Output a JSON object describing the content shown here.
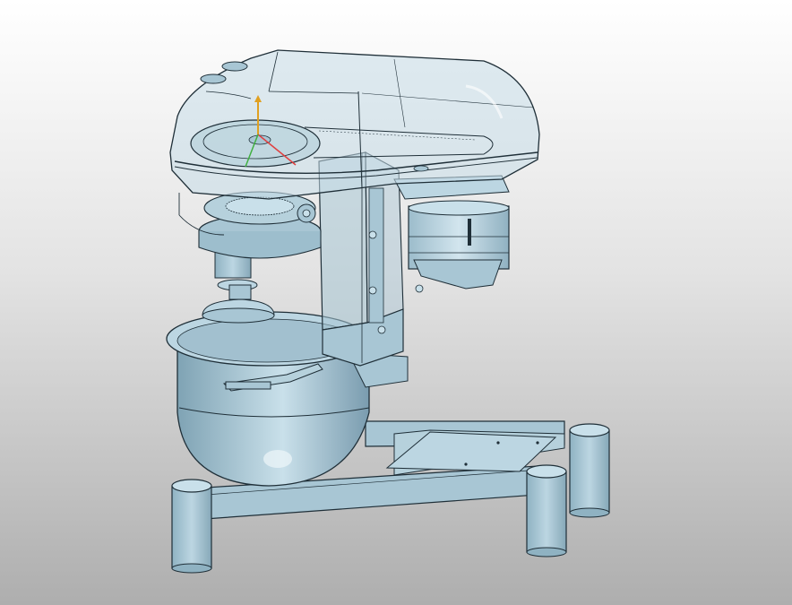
{
  "viewport": {
    "background_top": "#ffffff",
    "background_bottom": "#aeaeae",
    "model_fill": "#a8c6d4",
    "model_edge": "#1f2f38",
    "transparent_housing_fill": "#c7dde8"
  },
  "model": {
    "parts": [
      "transparent-housing",
      "pulley",
      "gear-assembly",
      "motor",
      "support-column",
      "mixing-bowl",
      "bowl-handle",
      "base-frame",
      "mounting-plate",
      "legs"
    ]
  },
  "axis_triad": {
    "x_color": "#e04040",
    "y_color": "#40b040",
    "z_color": "#e0a020"
  }
}
